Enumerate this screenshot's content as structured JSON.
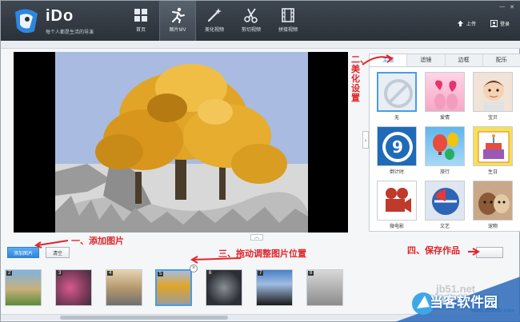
{
  "app": {
    "name": "iDo",
    "slogan": "每个人都是生活的导演"
  },
  "nav": [
    {
      "label": "首页",
      "icon": "home-grid-icon"
    },
    {
      "label": "图片MV",
      "icon": "figure-pose-icon",
      "active": true
    },
    {
      "label": "美化视频",
      "icon": "magic-wand-icon"
    },
    {
      "label": "剪切视频",
      "icon": "scissors-icon"
    },
    {
      "label": "拼接视频",
      "icon": "film-strip-icon"
    }
  ],
  "top_right": {
    "upload_label": "上传",
    "login_label": "登录"
  },
  "panel": {
    "tabs": [
      "主题",
      "滤镜",
      "边框",
      "配乐"
    ],
    "active_tab": "主题",
    "themes": [
      {
        "label": "无"
      },
      {
        "label": "爱情"
      },
      {
        "label": "宝贝"
      },
      {
        "label": "倒计时"
      },
      {
        "label": "旅行"
      },
      {
        "label": "生日"
      },
      {
        "label": "微电影"
      },
      {
        "label": "文艺"
      },
      {
        "label": "宠物"
      }
    ]
  },
  "buttons": {
    "add_photo": "添加图片",
    "clear": "清空"
  },
  "timeline": {
    "frames": [
      "2",
      "3",
      "4",
      "5",
      "6",
      "7",
      "8"
    ],
    "selected": "5"
  },
  "annotations": {
    "step1": "一、添加图片",
    "step2": "二、美化设置",
    "step3": "三、拖动调整图片位置",
    "step4": "四、保存作品"
  },
  "watermark": {
    "site": "jb51.net",
    "name": "当客软件园",
    "url": "www.downkr.com"
  },
  "colors": {
    "accent": "#2f86de",
    "annotation": "#e0262b",
    "topbar": "#2b3138"
  }
}
